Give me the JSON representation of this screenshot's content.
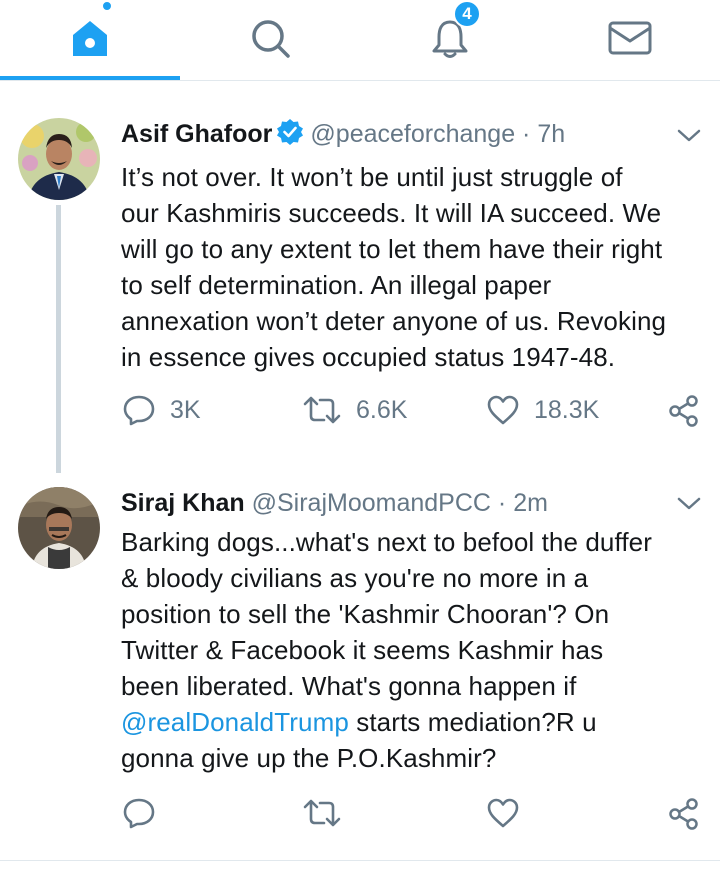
{
  "nav": {
    "tabs": [
      {
        "name": "home",
        "icon": "home-icon",
        "active": true
      },
      {
        "name": "search",
        "icon": "search-icon"
      },
      {
        "name": "notifications",
        "icon": "bell-icon",
        "badge": "4"
      },
      {
        "name": "messages",
        "icon": "mail-icon"
      }
    ],
    "notification_badge": "4",
    "accent_color": "#1da1f2"
  },
  "tweets": [
    {
      "name": "Asif Ghafoor",
      "verified": true,
      "handle": "@peaceforchange",
      "separator": "·",
      "time": "7h",
      "text": "It’s not over. It won’t be until just struggle of\nour Kashmiris succeeds. It will IA succeed. We\nwill go to any extent to let them have their right\nto self determination. An illegal paper\nannexation won’t deter anyone of us. Revoking\nin essence gives occupied status 1947-48.",
      "replies": "3K",
      "retweets": "6.6K",
      "likes": "18.3K"
    },
    {
      "name": "Siraj Khan",
      "verified": false,
      "handle": "@SirajMoomandPCC",
      "separator": "·",
      "time": "2m",
      "text_before": "Barking dogs...what's next to befool the duffer\n& bloody civilians as you're no more in a\nposition to sell the 'Kashmir Chooran'? On\nTwitter & Facebook it seems Kashmir has\nbeen liberated. What's gonna happen if\n",
      "mention": "@realDonaldTrump",
      "text_after": " starts mediation?R u\ngonna give up the P.O.Kashmir?",
      "replies": "",
      "retweets": "",
      "likes": ""
    }
  ]
}
